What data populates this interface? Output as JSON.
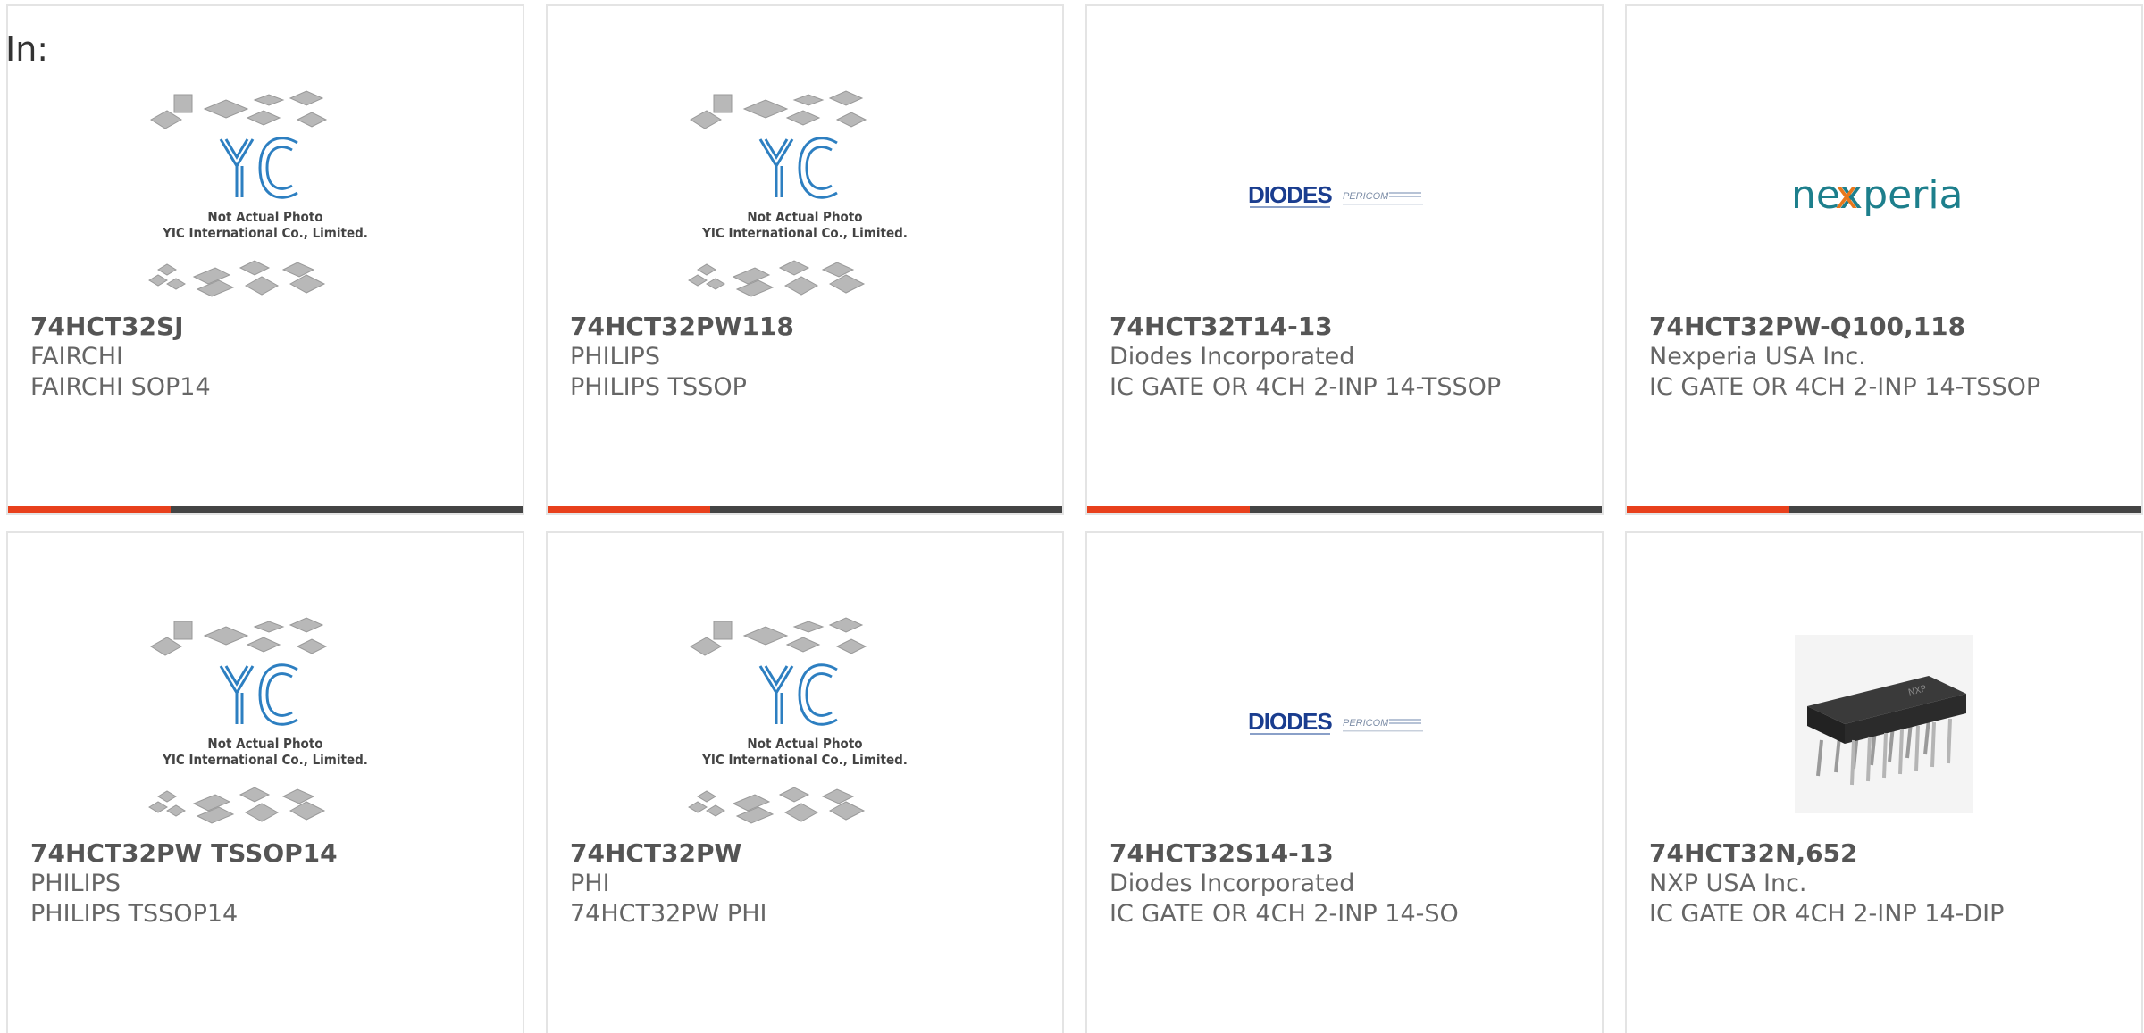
{
  "header": {
    "in_label": "In:"
  },
  "placeholder_caption": {
    "line1": "Not Actual Photo",
    "line2": "YIC International Co., Limited."
  },
  "brand_logos": {
    "diodes": "DIODES",
    "pericom": "PERICOM",
    "nexperia": "nexperia",
    "nexperia_x": "x",
    "chip_mark": "NXP"
  },
  "colors": {
    "accent": "#e8401c",
    "bar": "#444444",
    "yic_blue": "#2d7fc1",
    "diodes_blue": "#1a3d8f",
    "nexperia_teal": "#1d7f8c",
    "nexperia_orange": "#e8781c"
  },
  "products": [
    {
      "part_number": "74HCT32SJ",
      "manufacturer": "FAIRCHI",
      "description": "FAIRCHI SOP14",
      "image": "yic-placeholder"
    },
    {
      "part_number": "74HCT32PW118",
      "manufacturer": "PHILIPS",
      "description": "PHILIPS TSSOP",
      "image": "yic-placeholder"
    },
    {
      "part_number": "74HCT32T14-13",
      "manufacturer": "Diodes Incorporated",
      "description": "IC GATE OR 4CH 2-INP 14-TSSOP",
      "image": "diodes-logo"
    },
    {
      "part_number": "74HCT32PW-Q100,118",
      "manufacturer": "Nexperia USA Inc.",
      "description": "IC GATE OR 4CH 2-INP 14-TSSOP",
      "image": "nexperia-logo"
    },
    {
      "part_number": "74HCT32PW TSSOP14",
      "manufacturer": "PHILIPS",
      "description": "PHILIPS TSSOP14",
      "image": "yic-placeholder"
    },
    {
      "part_number": "74HCT32PW",
      "manufacturer": "PHI",
      "description": "74HCT32PW PHI",
      "image": "yic-placeholder"
    },
    {
      "part_number": "74HCT32S14-13",
      "manufacturer": "Diodes Incorporated",
      "description": "IC GATE OR 4CH 2-INP 14-SO",
      "image": "diodes-logo"
    },
    {
      "part_number": "74HCT32N,652",
      "manufacturer": "NXP USA Inc.",
      "description": "IC GATE OR 4CH 2-INP 14-DIP",
      "image": "dip-chip-photo"
    }
  ]
}
